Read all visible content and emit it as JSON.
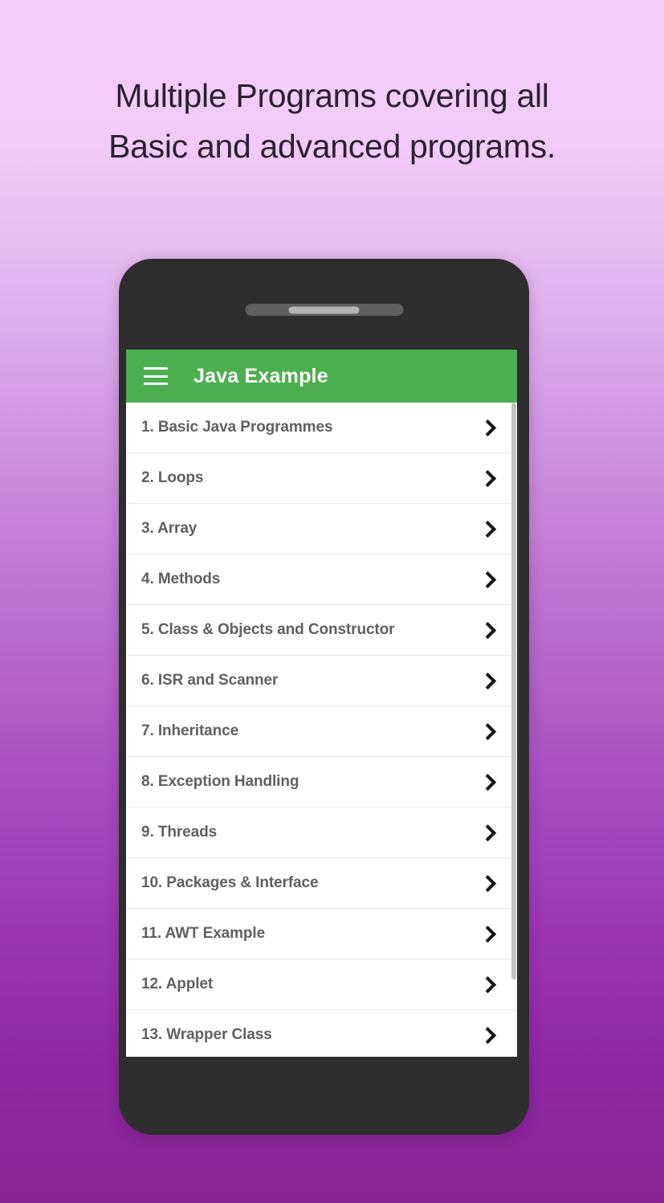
{
  "headline": {
    "line1": "Multiple Programs covering all",
    "line2": "Basic and advanced programs.",
    "color": "#2b2130"
  },
  "background": {
    "top_color": "#f4cdfb",
    "mid_color": "#c078d4",
    "bottom_color": "#8b2296"
  },
  "device": {
    "frame_color": "#2e2e2e",
    "speaker_outer_color": "#5f5f5f",
    "speaker_inner_color": "#b3b3b3"
  },
  "app": {
    "appbar": {
      "title": "Java Example",
      "background_color": "#4caf4f",
      "title_color": "#ffffff",
      "menu_icon": "hamburger-menu-icon"
    },
    "list": {
      "row_text_color": "#606060",
      "divider_color": "#e8e8e8",
      "chevron_icon": "chevron-right-icon",
      "items": [
        {
          "label": "1. Basic Java Programmes"
        },
        {
          "label": "2. Loops"
        },
        {
          "label": "3. Array"
        },
        {
          "label": "4. Methods"
        },
        {
          "label": "5. Class & Objects and Constructor"
        },
        {
          "label": "6. ISR and Scanner"
        },
        {
          "label": "7. Inheritance"
        },
        {
          "label": "8. Exception Handling"
        },
        {
          "label": "9. Threads"
        },
        {
          "label": "10. Packages & Interface"
        },
        {
          "label": "11. AWT Example"
        },
        {
          "label": "12. Applet"
        },
        {
          "label": "13. Wrapper Class"
        }
      ]
    },
    "scrollbar": {
      "thumb_color": "#c4c4c4"
    }
  }
}
